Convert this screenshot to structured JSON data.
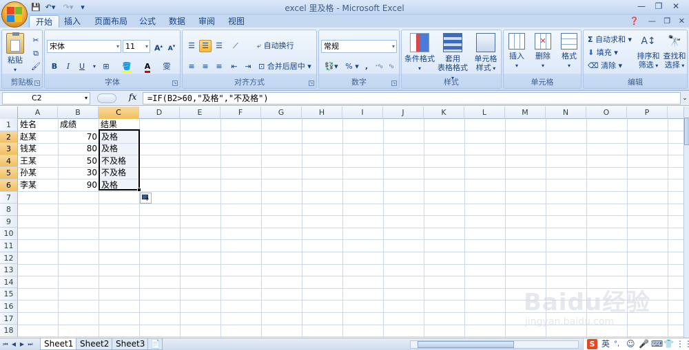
{
  "window": {
    "title": "excel 里及格 - Microsoft Excel"
  },
  "tabs": [
    "开始",
    "插入",
    "页面布局",
    "公式",
    "数据",
    "审阅",
    "视图"
  ],
  "ribbon": {
    "clipboard": {
      "label": "剪贴板",
      "paste": "粘贴"
    },
    "font": {
      "label": "字体",
      "name": "宋体",
      "size": "11",
      "bold": "B",
      "italic": "I",
      "underline": "U"
    },
    "alignment": {
      "label": "对齐方式",
      "wrap": "自动换行",
      "merge": "合并后居中"
    },
    "number": {
      "label": "数字",
      "format": "常规",
      "percent": "%",
      "comma": ","
    },
    "styles": {
      "label": "样式",
      "conditional": "条件格式",
      "table_line1": "套用",
      "table_line2": "表格格式",
      "cell_line1": "单元格",
      "cell_line2": "样式"
    },
    "cells": {
      "label": "单元格",
      "insert": "插入",
      "delete": "删除",
      "format": "格式"
    },
    "editing": {
      "label": "编辑",
      "autosum": "自动求和",
      "fill": "填充",
      "clear": "清除",
      "sort_line1": "排序和",
      "sort_line2": "筛选",
      "find_line1": "查找和",
      "find_line2": "选择"
    }
  },
  "formula_bar": {
    "name_box": "C2",
    "fx": "fx",
    "formula": "=IF(B2>60,\"及格\",\"不及格\")"
  },
  "grid": {
    "columns": [
      "A",
      "B",
      "C",
      "D",
      "E",
      "F",
      "G",
      "H",
      "I",
      "J",
      "K",
      "L",
      "M",
      "N",
      "O",
      "P"
    ],
    "rows": [
      "1",
      "2",
      "3",
      "4",
      "5",
      "6",
      "7",
      "8",
      "9",
      "10",
      "11",
      "12",
      "13",
      "14",
      "15",
      "16",
      "17",
      "18"
    ],
    "headers": [
      "姓名",
      "成绩",
      "结果"
    ],
    "data": [
      {
        "name": "赵某",
        "score": "70",
        "result": "及格"
      },
      {
        "name": "钱某",
        "score": "80",
        "result": "及格"
      },
      {
        "name": "王某",
        "score": "50",
        "result": "不及格"
      },
      {
        "name": "孙某",
        "score": "30",
        "result": "不及格"
      },
      {
        "name": "李某",
        "score": "90",
        "result": "及格"
      }
    ]
  },
  "sheets": [
    "Sheet1",
    "Sheet2",
    "Sheet3"
  ],
  "ime": {
    "lang": "英"
  },
  "watermark": {
    "brand": "Baidu经验",
    "url": "jingyan.baidu.com"
  }
}
